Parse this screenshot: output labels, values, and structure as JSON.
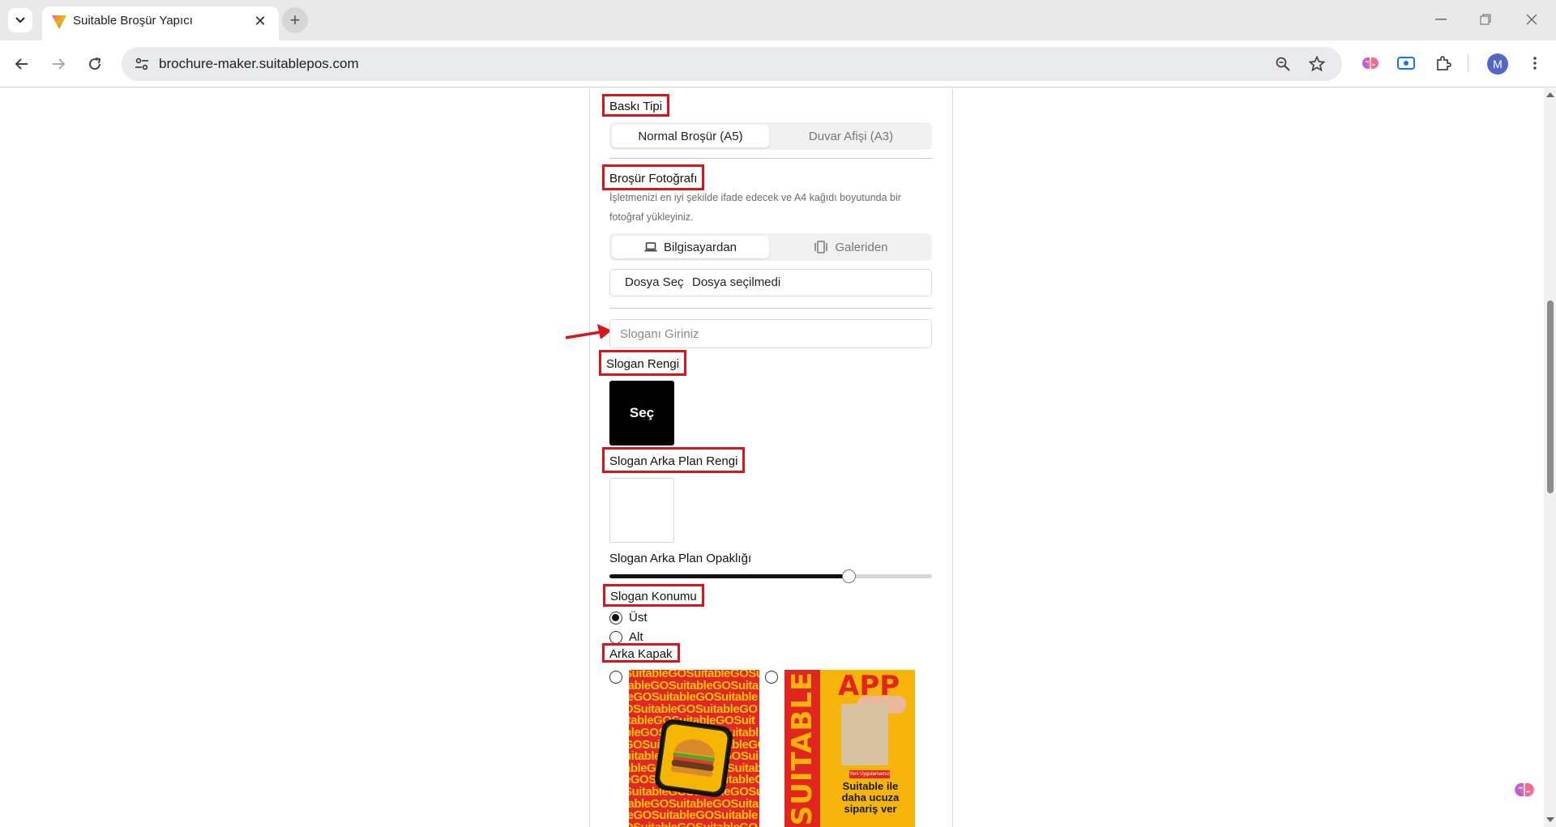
{
  "browser": {
    "tab_title": "Suitable Broşür Yapıcı",
    "url": "brochure-maker.suitablepos.com",
    "profile_initial": "M",
    "icons": [
      "tab-search-icon",
      "close-icon",
      "plus-icon",
      "minimize-icon",
      "restore-icon",
      "window-close-icon",
      "back-icon",
      "forward-icon",
      "reload-icon",
      "site-settings-icon",
      "zoom-icon",
      "bookmark-star-icon",
      "brain-extension-icon",
      "screen-capture-icon",
      "extensions-puzzle-icon",
      "more-menu-icon"
    ]
  },
  "form": {
    "print_type": {
      "label": "Baskı Tipi",
      "options": [
        "Normal Broşür (A5)",
        "Duvar Afişi (A3)"
      ],
      "selected": "Normal Broşür (A5)"
    },
    "photo": {
      "label": "Broşür Fotoğrafı",
      "hint": "İşletmenizi en iyi şekilde ifade edecek ve A4 kağıdı boyutunda bir fotoğraf yükleyiniz.",
      "sources": [
        "Bilgisayardan",
        "Galeriden"
      ],
      "selected_source": "Bilgisayardan",
      "file_button": "Dosya Seç",
      "file_status": "Dosya seçilmedi"
    },
    "slogan": {
      "placeholder": "Sloganı Giriniz",
      "value": ""
    },
    "slogan_color": {
      "label": "Slogan Rengi",
      "button": "Seç",
      "value": "#000000"
    },
    "slogan_bg_color": {
      "label": "Slogan Arka Plan Rengi",
      "value": "#ffffff"
    },
    "slogan_bg_opacity": {
      "label": "Slogan Arka Plan Opaklığı",
      "value_fraction": 0.74
    },
    "slogan_position": {
      "label": "Slogan Konumu",
      "options": [
        "Üst",
        "Alt"
      ],
      "selected": "Üst"
    },
    "back_cover": {
      "label": "Arka Kapak",
      "covers": [
        {
          "pattern_text": "SuitableGO"
        },
        {
          "side_text": "SUITABLE",
          "headline": "APP",
          "tag": "Yeni Uygulamamız",
          "promo": "Suitable ile daha ucuza sipariş ver"
        }
      ]
    }
  },
  "colors": {
    "annotation_red": "#d9151b",
    "cover_red": "#e3262a",
    "cover_yellow": "#f7b50b"
  }
}
